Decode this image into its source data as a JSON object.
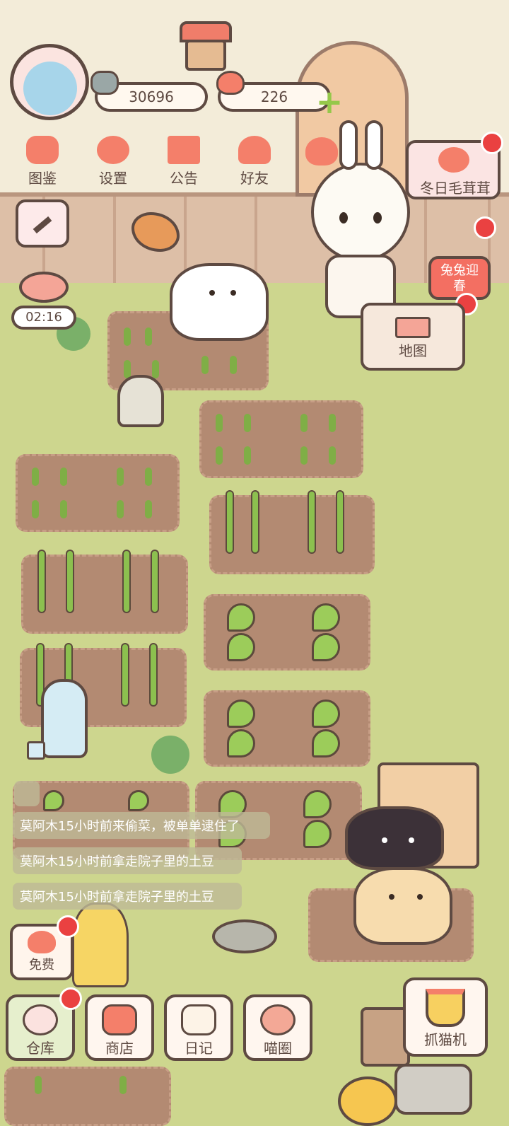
{
  "hud": {
    "coins": "30696",
    "hearts": "226"
  },
  "top_menu": [
    {
      "label": "图鉴",
      "icon": "cat-book-icon"
    },
    {
      "label": "设置",
      "icon": "gear-icon"
    },
    {
      "label": "公告",
      "icon": "gift-icon"
    },
    {
      "label": "好友",
      "icon": "friends-icon"
    }
  ],
  "event": {
    "winter_label": "冬日毛茸茸",
    "rabbit_label": "兔兔迎春",
    "map_label": "地图"
  },
  "timer": "02:16",
  "messages": [
    "莫阿木15小时前来偷菜，被单单逮住了",
    "莫阿木15小时前拿走院子里的土豆",
    "莫阿木15小时前拿走院子里的土豆"
  ],
  "free_label": "免费",
  "bottom_bar": [
    {
      "label": "仓库",
      "icon": "warehouse-icon"
    },
    {
      "label": "商店",
      "icon": "shop-icon"
    },
    {
      "label": "日记",
      "icon": "diary-icon"
    },
    {
      "label": "喵圈",
      "icon": "cat-planet-icon"
    }
  ],
  "claw_label": "抓猫机",
  "colors": {
    "accent": "#f47f6a",
    "outline": "#5e4a42",
    "badge": "#ea4141",
    "grass": "#cdd68e",
    "soil": "#b38a72"
  }
}
